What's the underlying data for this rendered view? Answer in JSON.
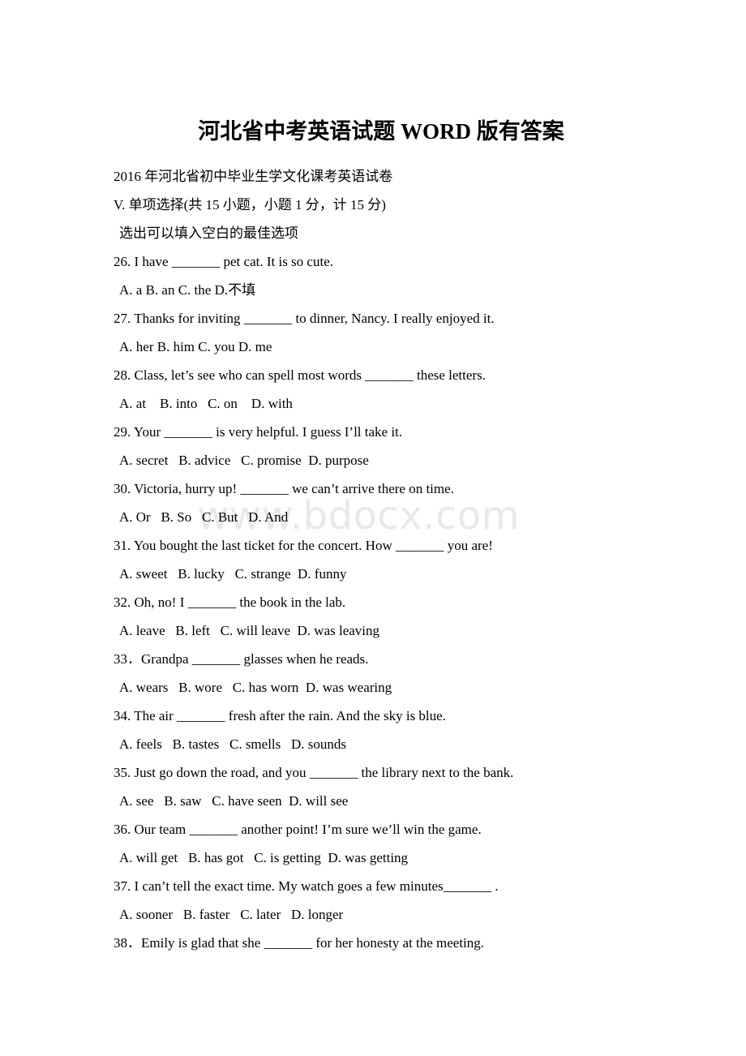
{
  "document": {
    "title": "河北省中考英语试题 WORD 版有答案",
    "subtitle": "2016 年河北省初中毕业生学文化课考英语试卷",
    "section_heading": "V. 单项选择(共 15 小题，小题 1 分，计 15 分)",
    "instruction": "选出可以填入空白的最佳选项",
    "watermark": "www.bdocx.com",
    "watermark_color": "#e9e9e9",
    "text_color": "#000000",
    "background_color": "#ffffff"
  },
  "questions": [
    {
      "stem": "26. I have _______ pet cat. It is so cute.",
      "options": "A. a B. an C. the D.不填"
    },
    {
      "stem": "27. Thanks for inviting _______ to dinner, Nancy. I really enjoyed it.",
      "options": "A. her B. him C. you D. me"
    },
    {
      "stem": "28. Class, let’s see who can spell most words _______ these letters.",
      "options": "A. at    B. into   C. on    D. with"
    },
    {
      "stem": "29. Your _______ is very helpful. I guess I’ll take it.",
      "options": "A. secret   B. advice   C. promise  D. purpose"
    },
    {
      "stem": "30. Victoria, hurry up! _______ we can’t arrive there on time.",
      "options": "A. Or   B. So   C. But   D. And"
    },
    {
      "stem": "31. You bought the last ticket for the concert. How _______ you are!",
      "options": "A. sweet   B. lucky   C. strange  D. funny"
    },
    {
      "stem": "32. Oh, no! I _______ the book in the lab.",
      "options": "A. leave   B. left   C. will leave  D. was leaving"
    },
    {
      "stem": "33．Grandpa _______ glasses when he reads.",
      "options": "A. wears   B. wore   C. has worn  D. was wearing"
    },
    {
      "stem": "34. The air _______ fresh after the rain. And the sky is blue.",
      "options": "A. feels   B. tastes   C. smells   D. sounds"
    },
    {
      "stem": "35. Just go down the road, and you _______ the library next to the bank.",
      "options": "A. see   B. saw   C. have seen  D. will see"
    },
    {
      "stem": "36. Our team _______ another point! I’m sure we’ll win the game.",
      "options": "A. will get   B. has got   C. is getting  D. was getting"
    },
    {
      "stem": "37. I can’t tell the exact time. My watch goes a few minutes_______ .",
      "options": "A. sooner   B. faster   C. later   D. longer"
    },
    {
      "stem": "38．Emily is glad that she _______ for her honesty at the meeting.",
      "options": null
    }
  ]
}
